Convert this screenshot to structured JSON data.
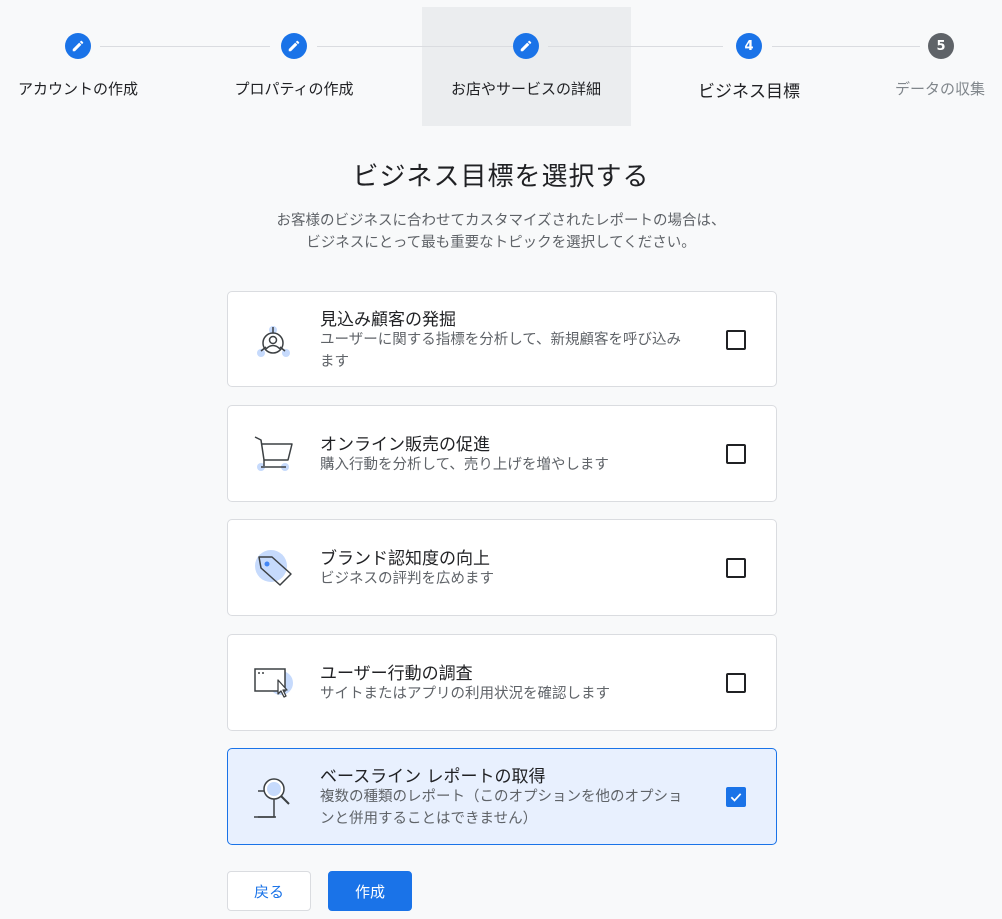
{
  "stepper": {
    "steps": [
      {
        "label": "アカウントの作成",
        "state": "done",
        "icon": "pencil-icon"
      },
      {
        "label": "プロパティの作成",
        "state": "done",
        "icon": "pencil-icon"
      },
      {
        "label": "お店やサービスの詳細",
        "state": "done",
        "icon": "pencil-icon"
      },
      {
        "label": "ビジネス目標",
        "state": "current",
        "number": "4"
      },
      {
        "label": "データの収集",
        "state": "pending",
        "number": "5"
      }
    ]
  },
  "main": {
    "title": "ビジネス目標を選択する",
    "description_line1": "お客様のビジネスに合わせてカスタマイズされたレポートの場合は、",
    "description_line2": "ビジネスにとって最も重要なトピックを選択してください。"
  },
  "options": [
    {
      "title": "見込み顧客の発掘",
      "desc_line1": "ユーザーに関する指標を分析して、新規顧客を呼び込み",
      "desc_line2": "ます",
      "icon": "user-network-icon",
      "checked": false
    },
    {
      "title": "オンライン販売の促進",
      "desc_line1": "購入行動を分析して、売り上げを増やします",
      "icon": "shopping-cart-icon",
      "checked": false
    },
    {
      "title": "ブランド認知度の向上",
      "desc_line1": "ビジネスの評判を広めます",
      "icon": "tag-icon",
      "checked": false
    },
    {
      "title": "ユーザー行動の調査",
      "desc_line1": "サイトまたはアプリの利用状況を確認します",
      "icon": "browser-cursor-icon",
      "checked": false
    },
    {
      "title": "ベースライン レポートの取得",
      "desc_line1": "複数の種類のレポート（このオプションを他のオプショ",
      "desc_line2": "ンと併用することはできません）",
      "icon": "magnifier-report-icon",
      "checked": true
    }
  ],
  "buttons": {
    "back_label": "戻る",
    "create_label": "作成"
  },
  "colors": {
    "accent": "#1a73e8",
    "selected_bg": "#e8f0fe",
    "pending_step": "#5f6368"
  }
}
